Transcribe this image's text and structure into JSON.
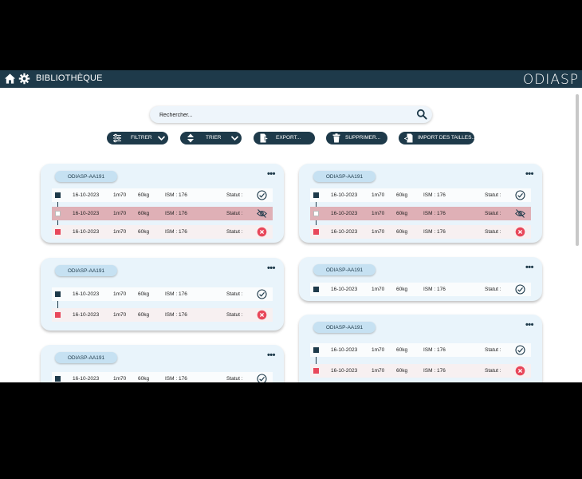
{
  "header": {
    "title": "BIBLIOTHÈQUE",
    "logo": "ODIASP"
  },
  "search": {
    "placeholder": "Rechercher..."
  },
  "toolbar": {
    "filter_label": "FILTRER",
    "sort_label": "TRIER",
    "export_label": "EXPORT...",
    "delete_label": "SUPPRIMER...",
    "import_label": "IMPORT DES TAILLES..."
  },
  "cards": [
    {
      "id": "ODIASP-AA191",
      "rows": [
        {
          "date": "16-10-2023",
          "height": "1m70",
          "weight": "60kg",
          "ism": "ISM : 176",
          "status_label": "Statut :",
          "status": "ok"
        },
        {
          "date": "16-10-2023",
          "height": "1m70",
          "weight": "60kg",
          "ism": "ISM : 176",
          "status_label": "Statut :",
          "status": "hidden"
        },
        {
          "date": "16-10-2023",
          "height": "1m70",
          "weight": "60kg",
          "ism": "ISM : 176",
          "status_label": "Statut :",
          "status": "error"
        }
      ]
    },
    {
      "id": "ODIASP-AA191",
      "rows": [
        {
          "date": "16-10-2023",
          "height": "1m70",
          "weight": "60kg",
          "ism": "ISM : 176",
          "status_label": "Statut :",
          "status": "ok"
        },
        {
          "date": "16-10-2023",
          "height": "1m70",
          "weight": "60kg",
          "ism": "ISM : 176",
          "status_label": "Statut :",
          "status": "hidden"
        },
        {
          "date": "16-10-2023",
          "height": "1m70",
          "weight": "60kg",
          "ism": "ISM : 176",
          "status_label": "Statut :",
          "status": "error"
        }
      ]
    },
    {
      "id": "ODIASP-AA191",
      "rows": [
        {
          "date": "16-10-2023",
          "height": "1m70",
          "weight": "60kg",
          "ism": "ISM : 176",
          "status_label": "Statut :",
          "status": "ok"
        },
        {
          "date": "16-10-2023",
          "height": "1m70",
          "weight": "60kg",
          "ism": "ISM : 176",
          "status_label": "Statut :",
          "status": "error"
        }
      ]
    },
    {
      "id": "ODIASP-AA191",
      "rows": [
        {
          "date": "16-10-2023",
          "height": "1m70",
          "weight": "60kg",
          "ism": "ISM : 176",
          "status_label": "Statut :",
          "status": "ok"
        }
      ]
    },
    {
      "id": "ODIASP-AA191",
      "rows": [
        {
          "date": "16-10-2023",
          "height": "1m70",
          "weight": "60kg",
          "ism": "ISM : 176",
          "status_label": "Statut :",
          "status": "ok"
        }
      ]
    },
    {
      "id": "ODIASP-AA191",
      "rows": [
        {
          "date": "16-10-2023",
          "height": "1m70",
          "weight": "60kg",
          "ism": "ISM : 176",
          "status_label": "Statut :",
          "status": "ok"
        },
        {
          "date": "16-10-2023",
          "height": "1m70",
          "weight": "60kg",
          "ism": "ISM : 176",
          "status_label": "Statut :",
          "status": "error"
        }
      ]
    }
  ],
  "icons": {
    "home": "home-icon",
    "settings": "gear-icon",
    "search": "search-icon",
    "filter": "sliders-icon",
    "sort": "sort-arrows-icon",
    "export": "export-file-icon",
    "delete": "trash-icon",
    "import": "import-file-icon",
    "more": "more-dots-icon",
    "status_ok": "check-circle-icon",
    "status_hidden": "eye-off-icon",
    "status_error": "x-circle-icon"
  },
  "colors": {
    "primary": "#1e3a4a",
    "card_bg": "#e9f4fb",
    "pill_bg": "#c6e1f2",
    "highlight_row": "#dfb0b6",
    "error_red": "#e8475a"
  }
}
